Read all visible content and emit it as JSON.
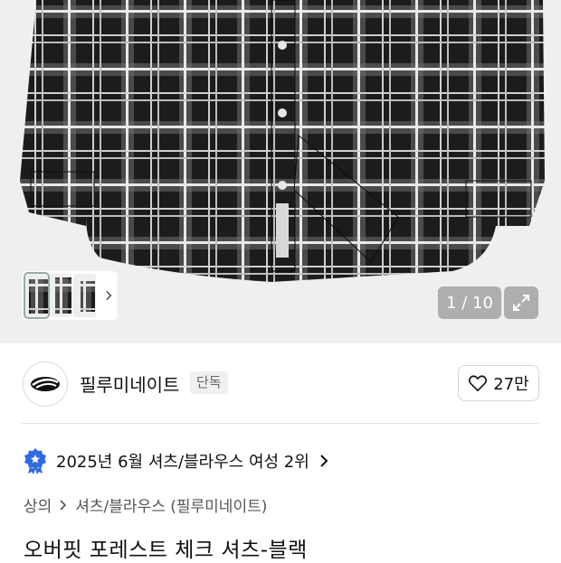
{
  "gallery": {
    "counter_text": "1 / 10",
    "thumbnails": [
      "thumbnail-1",
      "thumbnail-2",
      "thumbnail-3"
    ],
    "next_icon": "chevron-right-icon",
    "expand_icon": "expand-icon"
  },
  "brand": {
    "name": "필루미네이트",
    "badge": "단독",
    "like_count": "27만",
    "like_icon": "heart-icon"
  },
  "ranking": {
    "text": "2025년 6월 셔츠/블라우스 여성 2위",
    "icon": "medal-icon"
  },
  "breadcrumb": {
    "category": "상의",
    "subcategory": "셔츠/블라우스 (필루미네이트)"
  },
  "product": {
    "title": "오버핏 포레스트 체크 셔츠-블랙"
  },
  "colors": {
    "hero_bg": "#efefef",
    "rank_badge": "#2f6be0"
  }
}
